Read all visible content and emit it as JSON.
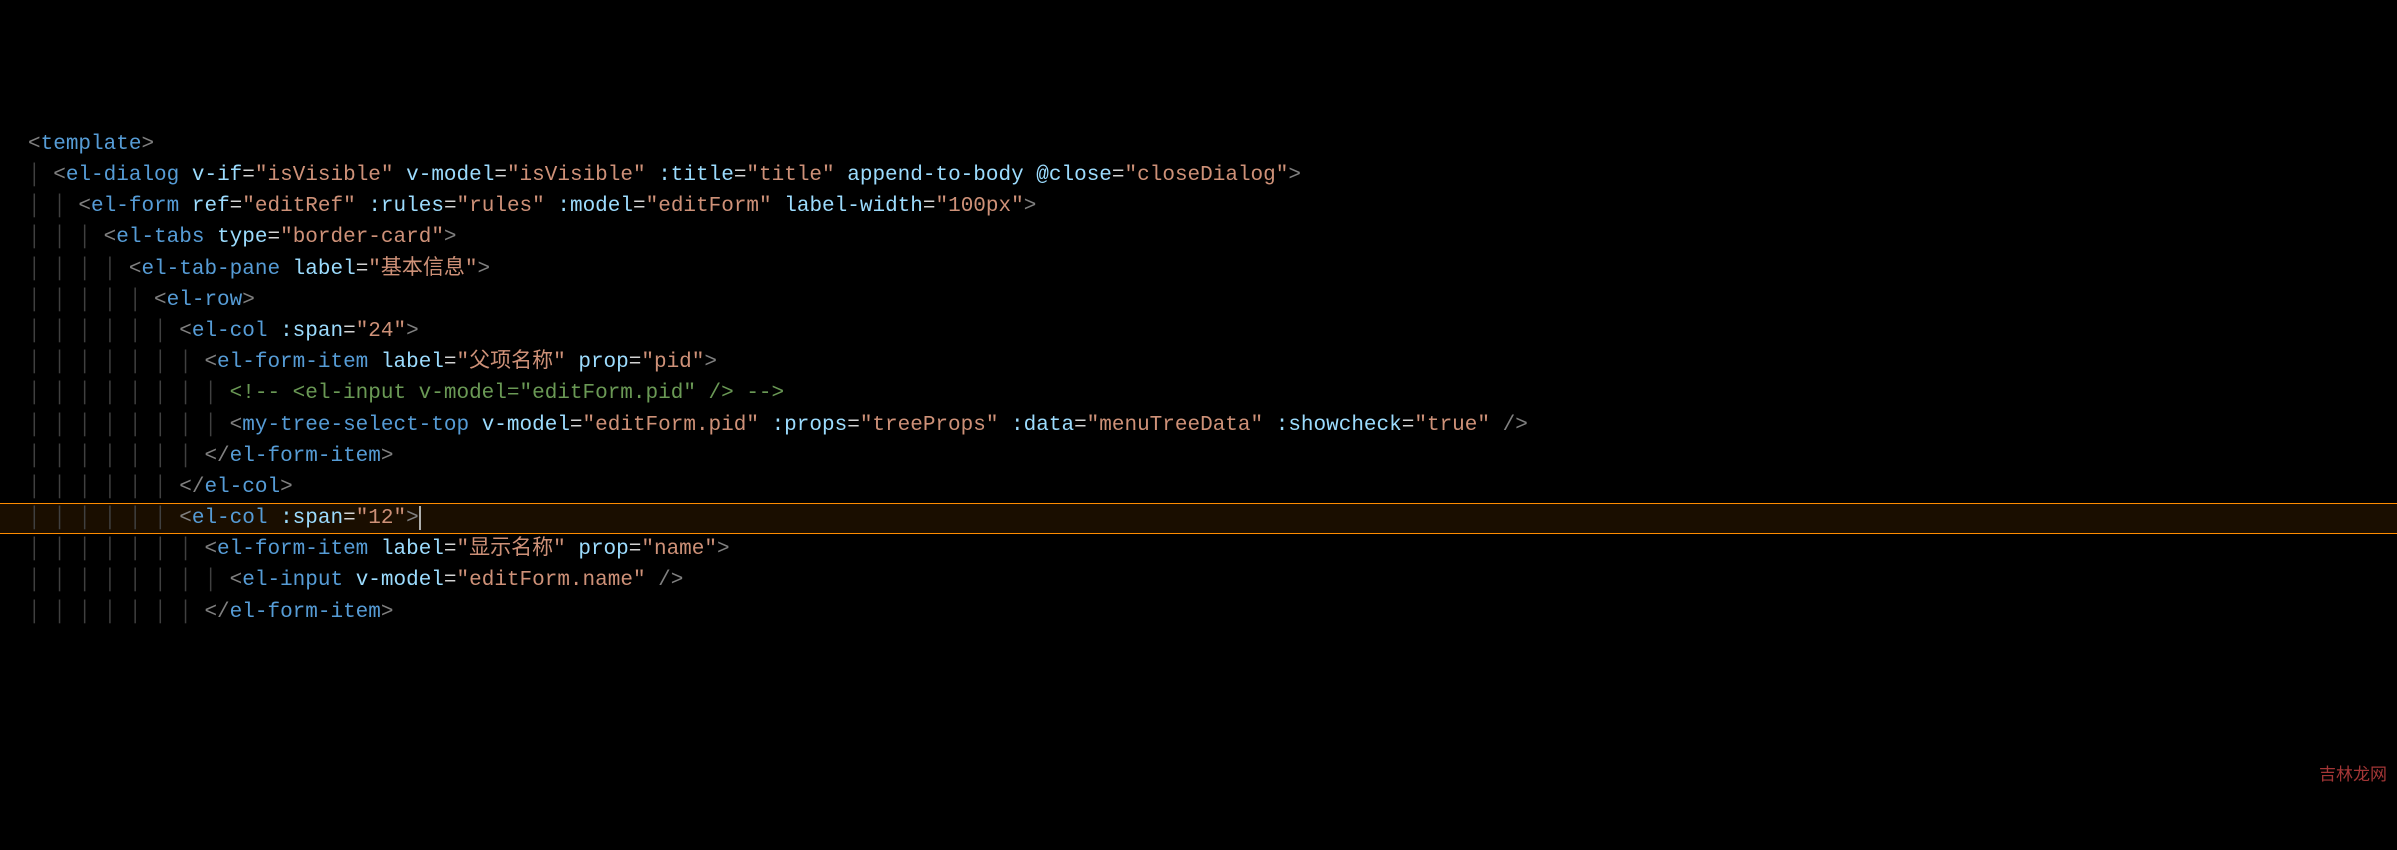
{
  "colors": {
    "background": "#000000",
    "tag": "#569cd6",
    "attr_name": "#9cdcfe",
    "attr_value": "#ce9178",
    "comment": "#6a9955",
    "bracket": "#808080",
    "highlight_border": "#ff8c00"
  },
  "watermark": "吉林龙网",
  "highlighted_line_index": 12,
  "lines": [
    {
      "indent": 0,
      "tokens": [
        {
          "t": "bracket",
          "v": "<"
        },
        {
          "t": "tag",
          "v": "template"
        },
        {
          "t": "bracket",
          "v": ">"
        }
      ]
    },
    {
      "indent": 1,
      "tokens": [
        {
          "t": "bracket",
          "v": "<"
        },
        {
          "t": "tag",
          "v": "el-dialog"
        },
        {
          "t": "punct",
          "v": " "
        },
        {
          "t": "attr-name",
          "v": "v-if"
        },
        {
          "t": "punct",
          "v": "="
        },
        {
          "t": "attr-value",
          "v": "\"isVisible\""
        },
        {
          "t": "punct",
          "v": " "
        },
        {
          "t": "attr-name",
          "v": "v-model"
        },
        {
          "t": "punct",
          "v": "="
        },
        {
          "t": "attr-value",
          "v": "\"isVisible\""
        },
        {
          "t": "punct",
          "v": " "
        },
        {
          "t": "attr-name",
          "v": ":title"
        },
        {
          "t": "punct",
          "v": "="
        },
        {
          "t": "attr-value",
          "v": "\"title\""
        },
        {
          "t": "punct",
          "v": " "
        },
        {
          "t": "attr-name",
          "v": "append-to-body"
        },
        {
          "t": "punct",
          "v": " "
        },
        {
          "t": "attr-name",
          "v": "@close"
        },
        {
          "t": "punct",
          "v": "="
        },
        {
          "t": "attr-value",
          "v": "\"closeDialog\""
        },
        {
          "t": "bracket",
          "v": ">"
        }
      ]
    },
    {
      "indent": 2,
      "tokens": [
        {
          "t": "bracket",
          "v": "<"
        },
        {
          "t": "tag",
          "v": "el-form"
        },
        {
          "t": "punct",
          "v": " "
        },
        {
          "t": "attr-name",
          "v": "ref"
        },
        {
          "t": "punct",
          "v": "="
        },
        {
          "t": "attr-value",
          "v": "\"editRef\""
        },
        {
          "t": "punct",
          "v": " "
        },
        {
          "t": "attr-name",
          "v": ":rules"
        },
        {
          "t": "punct",
          "v": "="
        },
        {
          "t": "attr-value",
          "v": "\"rules\""
        },
        {
          "t": "punct",
          "v": " "
        },
        {
          "t": "attr-name",
          "v": ":model"
        },
        {
          "t": "punct",
          "v": "="
        },
        {
          "t": "attr-value",
          "v": "\"editForm\""
        },
        {
          "t": "punct",
          "v": " "
        },
        {
          "t": "attr-name",
          "v": "label-width"
        },
        {
          "t": "punct",
          "v": "="
        },
        {
          "t": "attr-value",
          "v": "\"100px\""
        },
        {
          "t": "bracket",
          "v": ">"
        }
      ]
    },
    {
      "indent": 3,
      "tokens": [
        {
          "t": "bracket",
          "v": "<"
        },
        {
          "t": "tag",
          "v": "el-tabs"
        },
        {
          "t": "punct",
          "v": " "
        },
        {
          "t": "attr-name",
          "v": "type"
        },
        {
          "t": "punct",
          "v": "="
        },
        {
          "t": "attr-value",
          "v": "\"border-card\""
        },
        {
          "t": "bracket",
          "v": ">"
        }
      ]
    },
    {
      "indent": 4,
      "tokens": [
        {
          "t": "bracket",
          "v": "<"
        },
        {
          "t": "tag",
          "v": "el-tab-pane"
        },
        {
          "t": "punct",
          "v": " "
        },
        {
          "t": "attr-name",
          "v": "label"
        },
        {
          "t": "punct",
          "v": "="
        },
        {
          "t": "attr-value",
          "v": "\"基本信息\""
        },
        {
          "t": "bracket",
          "v": ">"
        }
      ]
    },
    {
      "indent": 5,
      "tokens": [
        {
          "t": "bracket",
          "v": "<"
        },
        {
          "t": "tag",
          "v": "el-row"
        },
        {
          "t": "bracket",
          "v": ">"
        }
      ]
    },
    {
      "indent": 6,
      "tokens": [
        {
          "t": "bracket",
          "v": "<"
        },
        {
          "t": "tag",
          "v": "el-col"
        },
        {
          "t": "punct",
          "v": " "
        },
        {
          "t": "attr-name",
          "v": ":span"
        },
        {
          "t": "punct",
          "v": "="
        },
        {
          "t": "attr-value",
          "v": "\"24\""
        },
        {
          "t": "bracket",
          "v": ">"
        }
      ]
    },
    {
      "indent": 7,
      "tokens": [
        {
          "t": "bracket",
          "v": "<"
        },
        {
          "t": "tag",
          "v": "el-form-item"
        },
        {
          "t": "punct",
          "v": " "
        },
        {
          "t": "attr-name",
          "v": "label"
        },
        {
          "t": "punct",
          "v": "="
        },
        {
          "t": "attr-value",
          "v": "\"父项名称\""
        },
        {
          "t": "punct",
          "v": " "
        },
        {
          "t": "attr-name",
          "v": "prop"
        },
        {
          "t": "punct",
          "v": "="
        },
        {
          "t": "attr-value",
          "v": "\"pid\""
        },
        {
          "t": "bracket",
          "v": ">"
        }
      ]
    },
    {
      "indent": 8,
      "tokens": [
        {
          "t": "comment",
          "v": "<!-- <el-input v-model=\"editForm.pid\" /> -->"
        }
      ]
    },
    {
      "indent": 8,
      "tokens": [
        {
          "t": "bracket",
          "v": "<"
        },
        {
          "t": "tag",
          "v": "my-tree-select-top"
        },
        {
          "t": "punct",
          "v": " "
        },
        {
          "t": "attr-name",
          "v": "v-model"
        },
        {
          "t": "punct",
          "v": "="
        },
        {
          "t": "attr-value",
          "v": "\"editForm.pid\""
        },
        {
          "t": "punct",
          "v": " "
        },
        {
          "t": "attr-name",
          "v": ":props"
        },
        {
          "t": "punct",
          "v": "="
        },
        {
          "t": "attr-value",
          "v": "\"treeProps\""
        },
        {
          "t": "punct",
          "v": " "
        },
        {
          "t": "attr-name",
          "v": ":data"
        },
        {
          "t": "punct",
          "v": "="
        },
        {
          "t": "attr-value",
          "v": "\"menuTreeData\""
        },
        {
          "t": "punct",
          "v": " "
        },
        {
          "t": "attr-name",
          "v": ":showcheck"
        },
        {
          "t": "punct",
          "v": "="
        },
        {
          "t": "attr-value",
          "v": "\"true\""
        },
        {
          "t": "punct",
          "v": " "
        },
        {
          "t": "bracket",
          "v": "/>"
        }
      ]
    },
    {
      "indent": 7,
      "tokens": [
        {
          "t": "bracket",
          "v": "</"
        },
        {
          "t": "tag",
          "v": "el-form-item"
        },
        {
          "t": "bracket",
          "v": ">"
        }
      ]
    },
    {
      "indent": 6,
      "tokens": [
        {
          "t": "bracket",
          "v": "</"
        },
        {
          "t": "tag",
          "v": "el-col"
        },
        {
          "t": "bracket",
          "v": ">"
        }
      ]
    },
    {
      "indent": 6,
      "tokens": [
        {
          "t": "bracket",
          "v": "<"
        },
        {
          "t": "tag",
          "v": "el-col"
        },
        {
          "t": "punct",
          "v": " "
        },
        {
          "t": "attr-name",
          "v": ":span"
        },
        {
          "t": "punct",
          "v": "="
        },
        {
          "t": "attr-value",
          "v": "\"12\""
        },
        {
          "t": "bracket",
          "v": ">"
        },
        {
          "t": "cursor",
          "v": ""
        }
      ]
    },
    {
      "indent": 7,
      "tokens": [
        {
          "t": "bracket",
          "v": "<"
        },
        {
          "t": "tag",
          "v": "el-form-item"
        },
        {
          "t": "punct",
          "v": " "
        },
        {
          "t": "attr-name",
          "v": "label"
        },
        {
          "t": "punct",
          "v": "="
        },
        {
          "t": "attr-value",
          "v": "\"显示名称\""
        },
        {
          "t": "punct",
          "v": " "
        },
        {
          "t": "attr-name",
          "v": "prop"
        },
        {
          "t": "punct",
          "v": "="
        },
        {
          "t": "attr-value",
          "v": "\"name\""
        },
        {
          "t": "bracket",
          "v": ">"
        }
      ]
    },
    {
      "indent": 8,
      "tokens": [
        {
          "t": "bracket",
          "v": "<"
        },
        {
          "t": "tag",
          "v": "el-input"
        },
        {
          "t": "punct",
          "v": " "
        },
        {
          "t": "attr-name",
          "v": "v-model"
        },
        {
          "t": "punct",
          "v": "="
        },
        {
          "t": "attr-value",
          "v": "\"editForm.name\""
        },
        {
          "t": "punct",
          "v": " "
        },
        {
          "t": "bracket",
          "v": "/>"
        }
      ]
    },
    {
      "indent": 7,
      "tokens": [
        {
          "t": "bracket",
          "v": "</"
        },
        {
          "t": "tag",
          "v": "el-form-item"
        },
        {
          "t": "bracket",
          "v": ">"
        }
      ]
    }
  ]
}
